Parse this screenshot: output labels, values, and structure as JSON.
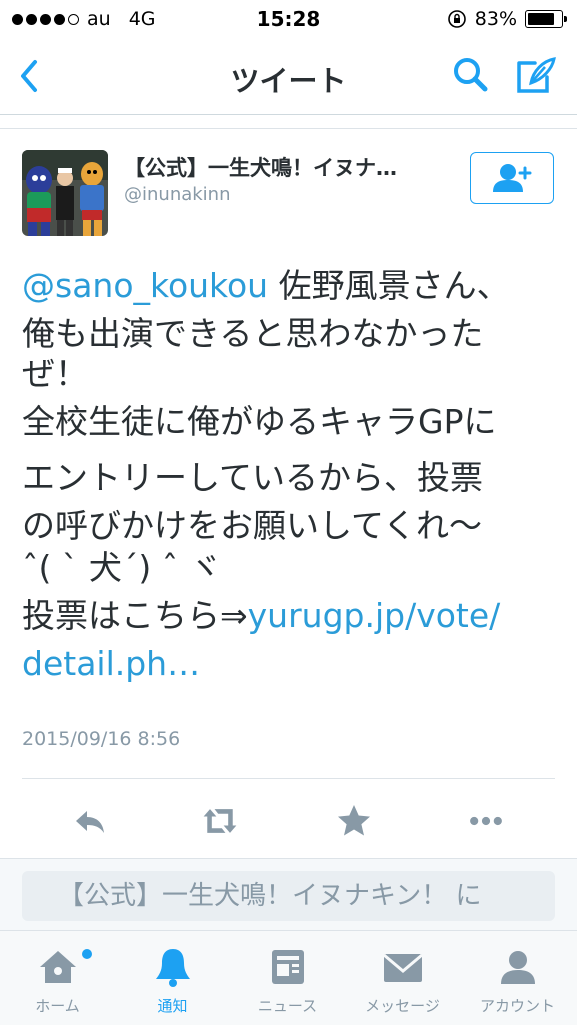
{
  "status_bar": {
    "carrier": "au",
    "network": "4G",
    "time": "15:28",
    "battery": "83%",
    "battery_level": 0.83
  },
  "nav": {
    "title": "ツイート",
    "back_icon": "chevron-left-icon",
    "search_icon": "search-icon",
    "compose_icon": "compose-icon"
  },
  "author": {
    "name": "【公式】一生犬鳴！イヌナ…",
    "handle": "@inunakinn",
    "follow_icon": "add-user-icon"
  },
  "tweet": {
    "mention": "@sano_koukou",
    "line1_rest": " 佐野風景さん、",
    "line2": "俺も出演できると思わなかった",
    "line3": "ぜ！",
    "line4": "全校生徒に俺がゆるキャラGPに",
    "line5": "エントリーしているから、投票",
    "line6": "の呼びかけをお願いしてくれ〜",
    "line7": "ˆ( ˋ 犬ˊ) ˆ ヾ",
    "line8_text": "投票はこちら⇒",
    "line8_link": "yurugp.jp/vote/",
    "line9_link": "detail.ph…",
    "timestamp": "2015/09/16 8:56"
  },
  "actions": [
    "reply-icon",
    "retweet-icon",
    "favorite-icon",
    "more-icon"
  ],
  "reply": {
    "placeholder": "【公式】一生犬鳴！イヌナキン！ に"
  },
  "tabs": [
    {
      "label": "ホーム",
      "icon": "home-icon",
      "active": false
    },
    {
      "label": "通知",
      "icon": "bell-icon",
      "active": true
    },
    {
      "label": "ニュース",
      "icon": "news-icon",
      "active": false
    },
    {
      "label": "メッセージ",
      "icon": "envelope-icon",
      "active": false
    },
    {
      "label": "アカウント",
      "icon": "account-icon",
      "active": false
    }
  ],
  "colors": {
    "accent": "#1da1f2",
    "link": "#2b9cd8",
    "text": "#292f33",
    "muted": "#8899a6"
  }
}
